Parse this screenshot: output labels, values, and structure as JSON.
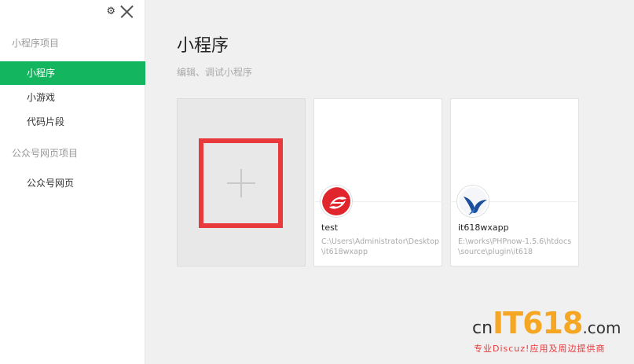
{
  "sidebar": {
    "section_miniprogram": "小程序项目",
    "items": [
      {
        "label": "小程序",
        "active": true
      },
      {
        "label": "小游戏",
        "active": false
      },
      {
        "label": "代码片段",
        "active": false
      }
    ],
    "section_webpage": "公众号网页项目",
    "webpage_item": "公众号网页",
    "icons": [
      "gear-icon",
      "close-icon"
    ],
    "accent_color": "#13b55f"
  },
  "main": {
    "title": "小程序",
    "subtitle": "编辑、调试小程序",
    "projects": [
      {
        "name": "test",
        "path": "C:\\Users\\Administrator\\Desktop\\it618wxapp",
        "icon": "red-logo-icon"
      },
      {
        "name": "it618wxapp",
        "path": "E:\\works\\PHPnow-1.5.6\\htdocs\\source\\plugin\\it618",
        "icon": "bird-logo-icon"
      }
    ],
    "new_project_icon": "plus-icon",
    "highlight_color": "#e8393c"
  },
  "watermark": {
    "cn": "cn",
    "it": "IT618",
    "com": ".com",
    "sub": "专业Discuz!应用及周边提供商"
  }
}
